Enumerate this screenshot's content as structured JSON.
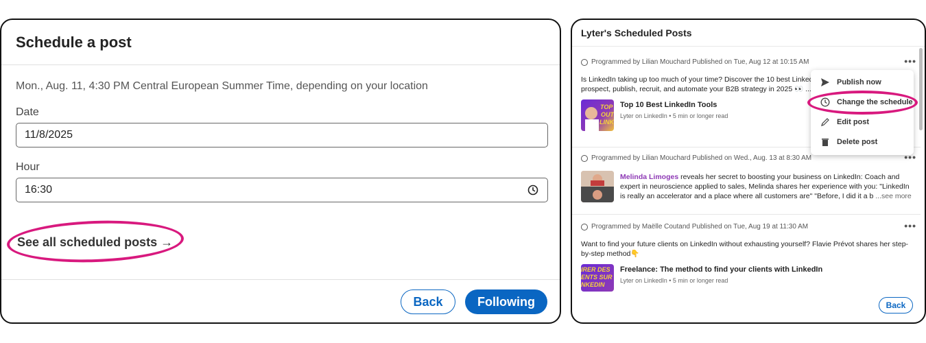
{
  "left": {
    "title": "Schedule a post",
    "info": "Mon., Aug. 11, 4:30 PM Central European Summer Time, depending on your location",
    "date_label": "Date",
    "date_value": "11/8/2025",
    "hour_label": "Hour",
    "hour_value": "16:30",
    "see_all": "See all scheduled posts →",
    "back_label": "Back",
    "following_label": "Following"
  },
  "right": {
    "title": "Lyter's Scheduled Posts",
    "back_label": "Back",
    "posts": [
      {
        "meta": "Programmed by Lilian Mouchard Published on Tue, Aug 12 at 10:15 AM",
        "text_line1": "Is LinkedIn taking up too much of your time? Discover the 10 best Linked",
        "text_line2": "prospect, publish, recruit, and automate your B2B strategy in 2025 👀 ...",
        "article_title": "Top 10 Best LinkedIn Tools",
        "article_sub": "Lyter on LinkedIn • 5 min or longer read",
        "thumb_text": "TOP OUT LINKE"
      },
      {
        "meta": "Programmed by Lilian Mouchard Published on Wed., Aug. 13 at 8:30 AM",
        "author": "Melinda Limoges",
        "text_line1": " reveals her secret to boosting your business on LinkedIn: Coach and",
        "text_line2": "expert in neuroscience applied to sales, Melinda shares her experience with you: \"LinkedIn",
        "text_line3": "is really an accelerator and a place where all customers are\" \"Before, I did it a b",
        "see_more": " ...see more"
      },
      {
        "meta": "Programmed by Maëlle Coutand Published on Tue, Aug 19 at 11:30 AM",
        "text_line1": "Want to find your future clients on LinkedIn without exhausting yourself? Flavie Prévot shares her step-",
        "text_line2": "by-step method👇",
        "article_title": "Freelance: The method to find your clients with LinkedIn",
        "article_sub": "Lyter on LinkedIn • 5 min or longer read",
        "thumb_text": "IRER DES ENTS SUR NKEDIN"
      }
    ],
    "menu": {
      "publish_now": "Publish now",
      "change_schedule": "Change the schedule",
      "edit_post": "Edit post",
      "delete_post": "Delete post"
    },
    "dots": "•••"
  },
  "colors": {
    "accent": "#0a66c2",
    "highlight": "#d8197e",
    "author": "#8e3ab5"
  }
}
